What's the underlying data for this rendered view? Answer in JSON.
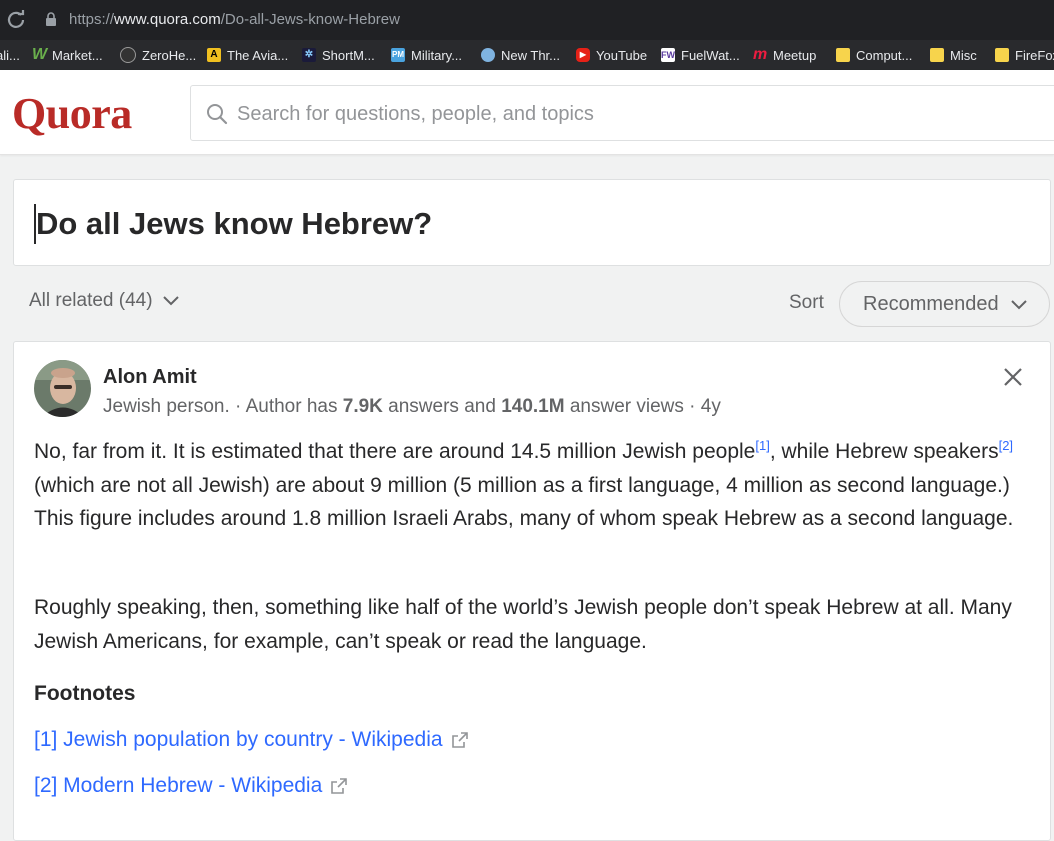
{
  "browser": {
    "url_prefix": "https://",
    "url_host": "www.quora.com",
    "url_path": "/Do-all-Jews-know-Hebrew",
    "bookmarks": [
      {
        "label": "ali...",
        "icon": "bookmark-icon"
      },
      {
        "label": "Market...",
        "icon": "w-icon"
      },
      {
        "label": "ZeroHe...",
        "icon": "zerohedge-icon"
      },
      {
        "label": "The Avia...",
        "icon": "aviation-icon"
      },
      {
        "label": "ShortM...",
        "icon": "shortm-icon"
      },
      {
        "label": "Military...",
        "icon": "pm-icon"
      },
      {
        "label": "New Thr...",
        "icon": "newthread-icon"
      },
      {
        "label": "YouTube",
        "icon": "youtube-icon"
      },
      {
        "label": "FuelWat...",
        "icon": "fuelwatch-icon"
      },
      {
        "label": "Meetup",
        "icon": "meetup-icon"
      },
      {
        "label": "Comput...",
        "icon": "folder-icon"
      },
      {
        "label": "Misc",
        "icon": "folder-icon"
      },
      {
        "label": "FireFox",
        "icon": "folder-icon"
      }
    ]
  },
  "header": {
    "logo": "Quora",
    "search_placeholder": "Search for questions, people, and topics"
  },
  "question": {
    "title": "Do all Jews know Hebrew?"
  },
  "filters": {
    "all_related": "All related (44)",
    "sort_label": "Sort",
    "sort_value": "Recommended"
  },
  "answer": {
    "author": "Alon Amit",
    "credential": "Jewish person.",
    "meta_prefix": "· Author has",
    "answers_count": "7.9K",
    "answers_label": "answers and",
    "views_count": "140.1M",
    "views_label": "answer views · 4y",
    "p1": {
      "a": "No, far from it. It is estimated that there are around 14.5 million Jewish people",
      "ref1": "[1]",
      "b": ", while Hebrew speakers",
      "ref2": "[2]",
      "c": " (which are not all Jewish) are about 9 million (5 million as a first language, 4 million as second language.) This figure includes around 1.8 million Israeli Arabs, many of whom speak Hebrew as a second language."
    },
    "p2": "Roughly speaking, then, something like half of the world’s Jewish people don’t speak Hebrew at all. Many Jewish Americans, for example, can’t speak or read the language.",
    "footnotes_heading": "Footnotes",
    "footnotes": [
      "[1] Jewish population by country - Wikipedia",
      "[2] Modern Hebrew - Wikipedia"
    ]
  },
  "colors": {
    "brand": "#b92b27",
    "link": "#2e69ff",
    "text": "#282829",
    "muted": "#636466"
  }
}
